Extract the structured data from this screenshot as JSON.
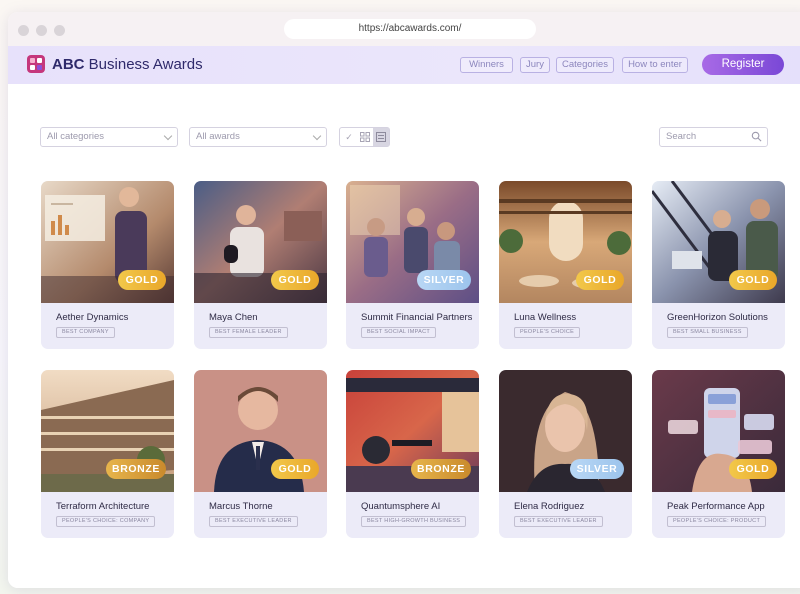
{
  "browser": {
    "url": "https://abcawards.com/"
  },
  "header": {
    "brand_bold": "ABC",
    "brand_rest": " Business Awards",
    "nav": [
      "Winners",
      "Jury",
      "Categories",
      "How to enter"
    ],
    "register_label": "Register"
  },
  "filters": {
    "categories_select": "All categories",
    "awards_select": "All awards",
    "search_placeholder": "Search"
  },
  "cards": [
    {
      "title": "Aether Dynamics",
      "tag": "BEST COMPANY",
      "award": "GOLD"
    },
    {
      "title": "Maya Chen",
      "tag": "BEST FEMALE LEADER",
      "award": "GOLD"
    },
    {
      "title": "Summit Financial Partners",
      "tag": "BEST SOCIAL IMPACT",
      "award": "SILVER"
    },
    {
      "title": "Luna Wellness",
      "tag": "PEOPLE'S CHOICE",
      "award": "GOLD"
    },
    {
      "title": "GreenHorizon Solutions",
      "tag": "BEST SMALL BUSINESS",
      "award": "GOLD"
    },
    {
      "title": "Terraform Architecture",
      "tag": "PEOPLE'S CHOICE: COMPANY",
      "award": "BRONZE"
    },
    {
      "title": "Marcus Thorne",
      "tag": "BEST EXECUTIVE LEADER",
      "award": "GOLD"
    },
    {
      "title": "Quantumsphere AI",
      "tag": "BEST HIGH-GROWTH BUSINESS",
      "award": "BRONZE"
    },
    {
      "title": "Elena Rodriguez",
      "tag": "BEST EXECUTIVE LEADER",
      "award": "SILVER"
    },
    {
      "title": "Peak Performance App",
      "tag": "PEOPLE'S CHOICE: PRODUCT",
      "award": "GOLD"
    }
  ],
  "colors": {
    "accent": "#7a48d6",
    "gold": "#e9a72a",
    "silver": "#9cc4ec",
    "bronze": "#c98a2c"
  }
}
